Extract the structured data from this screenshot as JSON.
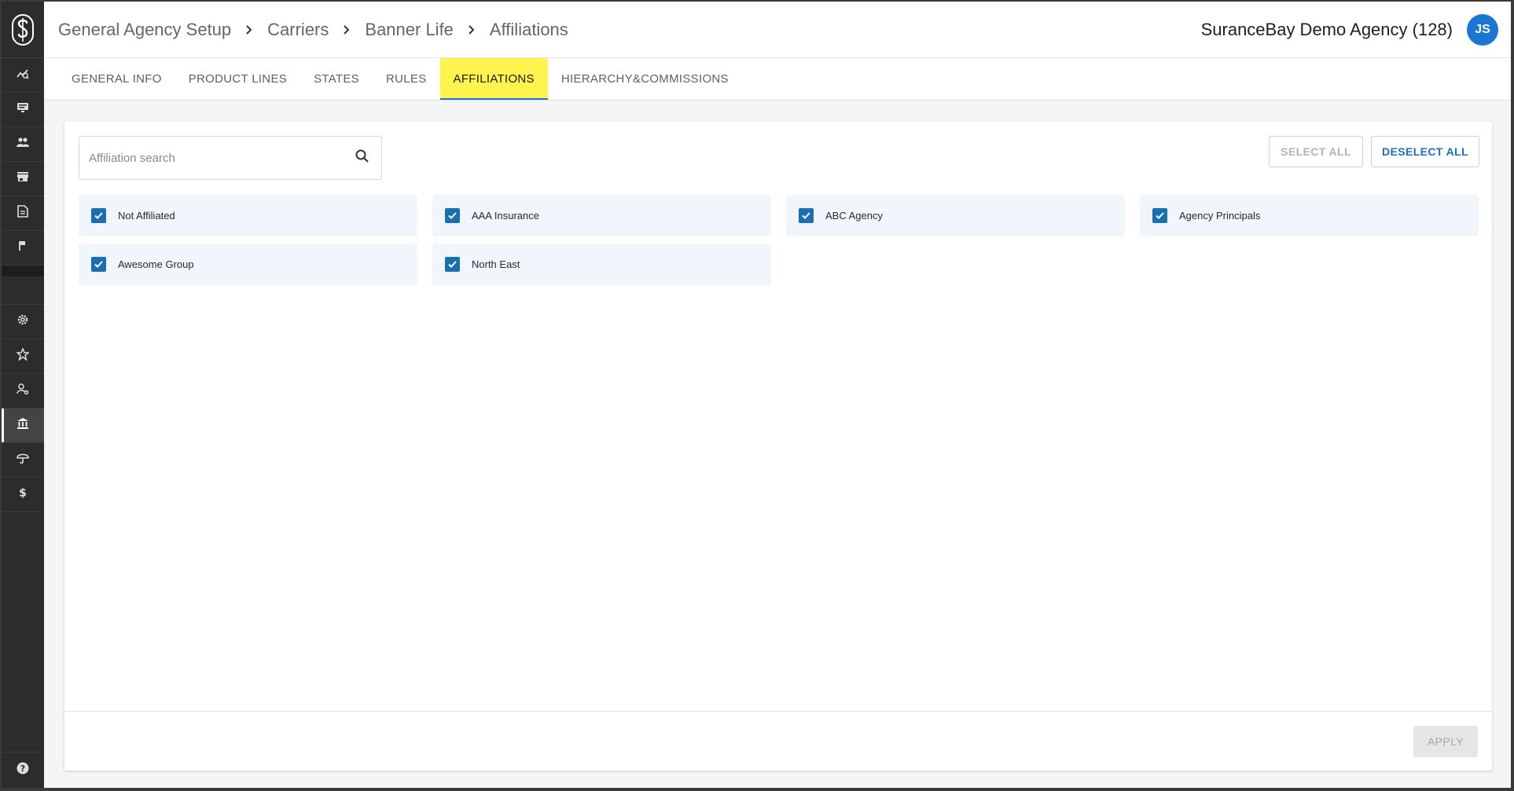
{
  "header": {
    "breadcrumb": [
      "General Agency Setup",
      "Carriers",
      "Banner Life",
      "Affiliations"
    ],
    "agency_name": "SuranceBay Demo Agency (128)",
    "avatar_initials": "JS"
  },
  "sidebar": {
    "logo_icon": "surancebay-logo-icon",
    "top_items": [
      {
        "icon": "analytics-icon"
      },
      {
        "icon": "monitor-icon"
      },
      {
        "icon": "people-icon"
      },
      {
        "icon": "store-icon"
      },
      {
        "icon": "document-icon"
      },
      {
        "icon": "flag-icon"
      }
    ],
    "bottom_items": [
      {
        "icon": "gear-icon"
      },
      {
        "icon": "badge-icon"
      },
      {
        "icon": "user-settings-icon"
      },
      {
        "icon": "bank-icon",
        "active": true
      },
      {
        "icon": "umbrella-icon"
      },
      {
        "icon": "dollar-icon"
      }
    ],
    "help_icon": "help-icon"
  },
  "tabs": [
    {
      "label": "GENERAL INFO"
    },
    {
      "label": "PRODUCT LINES"
    },
    {
      "label": "STATES"
    },
    {
      "label": "RULES"
    },
    {
      "label": "AFFILIATIONS",
      "active": true
    },
    {
      "label": "HIERARCHY&COMMISSIONS"
    }
  ],
  "search": {
    "placeholder": "Affiliation search",
    "value": ""
  },
  "actions": {
    "select_all": "SELECT ALL",
    "deselect_all": "DESELECT ALL",
    "apply": "APPLY"
  },
  "affiliations": [
    {
      "label": "Not Affiliated",
      "checked": true
    },
    {
      "label": "AAA Insurance",
      "checked": true
    },
    {
      "label": "ABC Agency",
      "checked": true
    },
    {
      "label": "Agency Principals",
      "checked": true
    },
    {
      "label": "Awesome Group",
      "checked": true
    },
    {
      "label": "North East",
      "checked": true
    }
  ],
  "colors": {
    "accent": "#1976d2",
    "active_tab_bg": "#fff34d",
    "sidebar_bg": "#2c2c2c",
    "checkbox": "#1a6fb0",
    "item_bg": "#f0f6fb"
  }
}
